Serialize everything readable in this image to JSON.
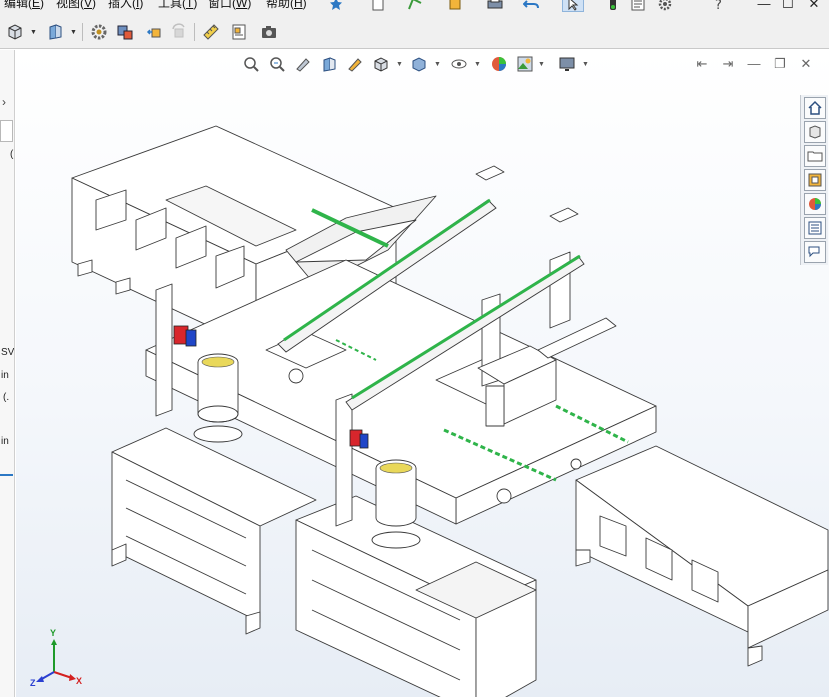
{
  "menubar": {
    "items": [
      {
        "label": "编辑(",
        "key": "E",
        "suffix": ")"
      },
      {
        "label": "视图(",
        "key": "V",
        "suffix": ")"
      },
      {
        "label": "插入(",
        "key": "I",
        "suffix": ")"
      },
      {
        "label": "工具(",
        "key": "T",
        "suffix": ")"
      },
      {
        "label": "窗口(",
        "key": "W",
        "suffix": ")"
      },
      {
        "label": "帮助(",
        "key": "H",
        "suffix": ")"
      }
    ],
    "pin_icon": "pin-icon",
    "window_controls": {
      "minimize": "—",
      "restore": "☐",
      "close": "✕"
    }
  },
  "quick_access": [
    "new-document-icon",
    "sketch-icon",
    "rebuild-icon",
    "print-icon",
    "undo-icon",
    "select-pointer-icon",
    "traffic-light-icon",
    "file-properties-icon",
    "options-gear-icon",
    "help-icon"
  ],
  "command_toolbar": [
    "view-orientation-icon",
    "section-view-icon",
    "gear-settings-icon",
    "mate-icon",
    "move-component-icon",
    "rotate-component-icon",
    "measure-icon",
    "bill-of-materials-icon",
    "camera-icon"
  ],
  "left_panel": {
    "lines": [
      "(",
      "SV",
      "in",
      "(.",
      "in"
    ],
    "arrow": "›"
  },
  "headsup_toolbar": [
    "zoom-to-fit-icon",
    "zoom-to-area-icon",
    "previous-view-icon",
    "section-view-icon",
    "dynamic-annotation-icon",
    "view-orientation-icon",
    "display-style-icon",
    "hide-show-icon",
    "edit-appearance-icon",
    "apply-scene-icon",
    "view-settings-icon"
  ],
  "viewport_controls": [
    "tile-left-icon",
    "tile-right-icon",
    "minimize-icon",
    "restore-icon",
    "close-icon"
  ],
  "task_pane": [
    "home-icon",
    "design-library-icon",
    "file-explorer-icon",
    "view-palette-icon",
    "appearances-icon",
    "custom-properties-icon",
    "forum-icon"
  ],
  "triad": {
    "x": "X",
    "y": "Y",
    "z": "Z",
    "colors": {
      "x": "#d42020",
      "y": "#1f9a2a",
      "z": "#2a3fd1"
    }
  },
  "colors": {
    "accent": "#2c78c4",
    "model_line": "#3a3a3a",
    "rail_green": "#2fb44a",
    "motor_red": "#d8262c",
    "motor_blue": "#2046c8",
    "cup_yellow": "#e9d85a"
  }
}
